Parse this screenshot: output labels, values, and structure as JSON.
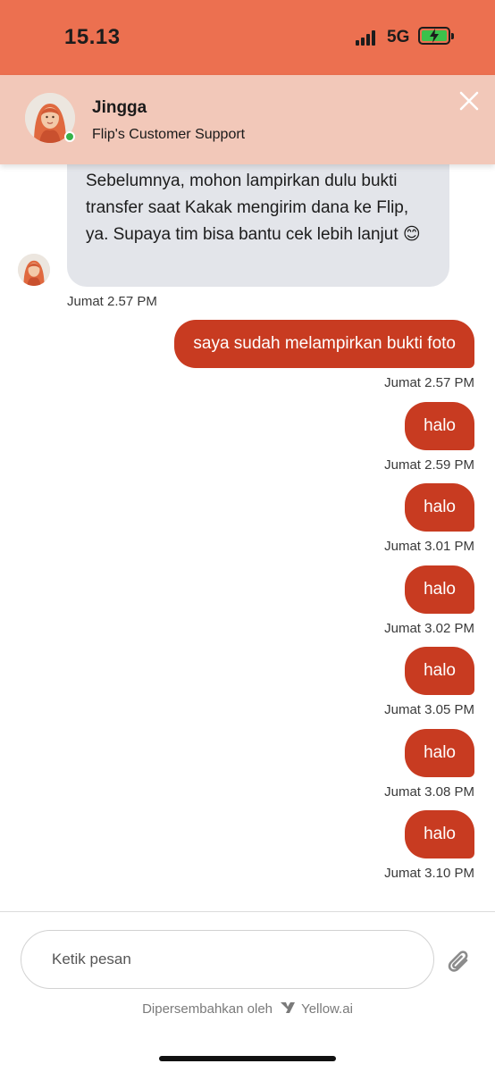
{
  "status_bar": {
    "time": "15.13",
    "network": "5G"
  },
  "header": {
    "agent_name": "Jingga",
    "agent_role": "Flip's Customer Support",
    "close_icon": "close-icon",
    "online_status_color": "#36b34a"
  },
  "messages": {
    "bot_message": {
      "text": "Sebelumnya, mohon lampirkan dulu bukti transfer saat Kakak mengirim dana ke Flip, ya. Supaya tim bisa bantu cek lebih lanjut 😊",
      "time": "Jumat 2.57 PM"
    },
    "user_messages": [
      {
        "text": "saya sudah melampirkan bukti foto",
        "time": "Jumat 2.57 PM"
      },
      {
        "text": "halo",
        "time": "Jumat 2.59 PM"
      },
      {
        "text": "halo",
        "time": "Jumat 3.01 PM"
      },
      {
        "text": "halo",
        "time": "Jumat 3.02 PM"
      },
      {
        "text": "halo",
        "time": "Jumat 3.05 PM"
      },
      {
        "text": "halo",
        "time": "Jumat 3.08 PM"
      },
      {
        "text": "halo",
        "time": "Jumat 3.10 PM"
      }
    ]
  },
  "composer": {
    "placeholder": "Ketik pesan",
    "attach_icon": "paperclip-icon",
    "powered_by": "Dipersembahkan oleh",
    "brand": "Yellow.ai"
  },
  "colors": {
    "status_bar": "#ec7050",
    "header": "#f2c8b9",
    "user_bubble": "#c83b21",
    "bot_bubble": "#e3e5ea"
  }
}
